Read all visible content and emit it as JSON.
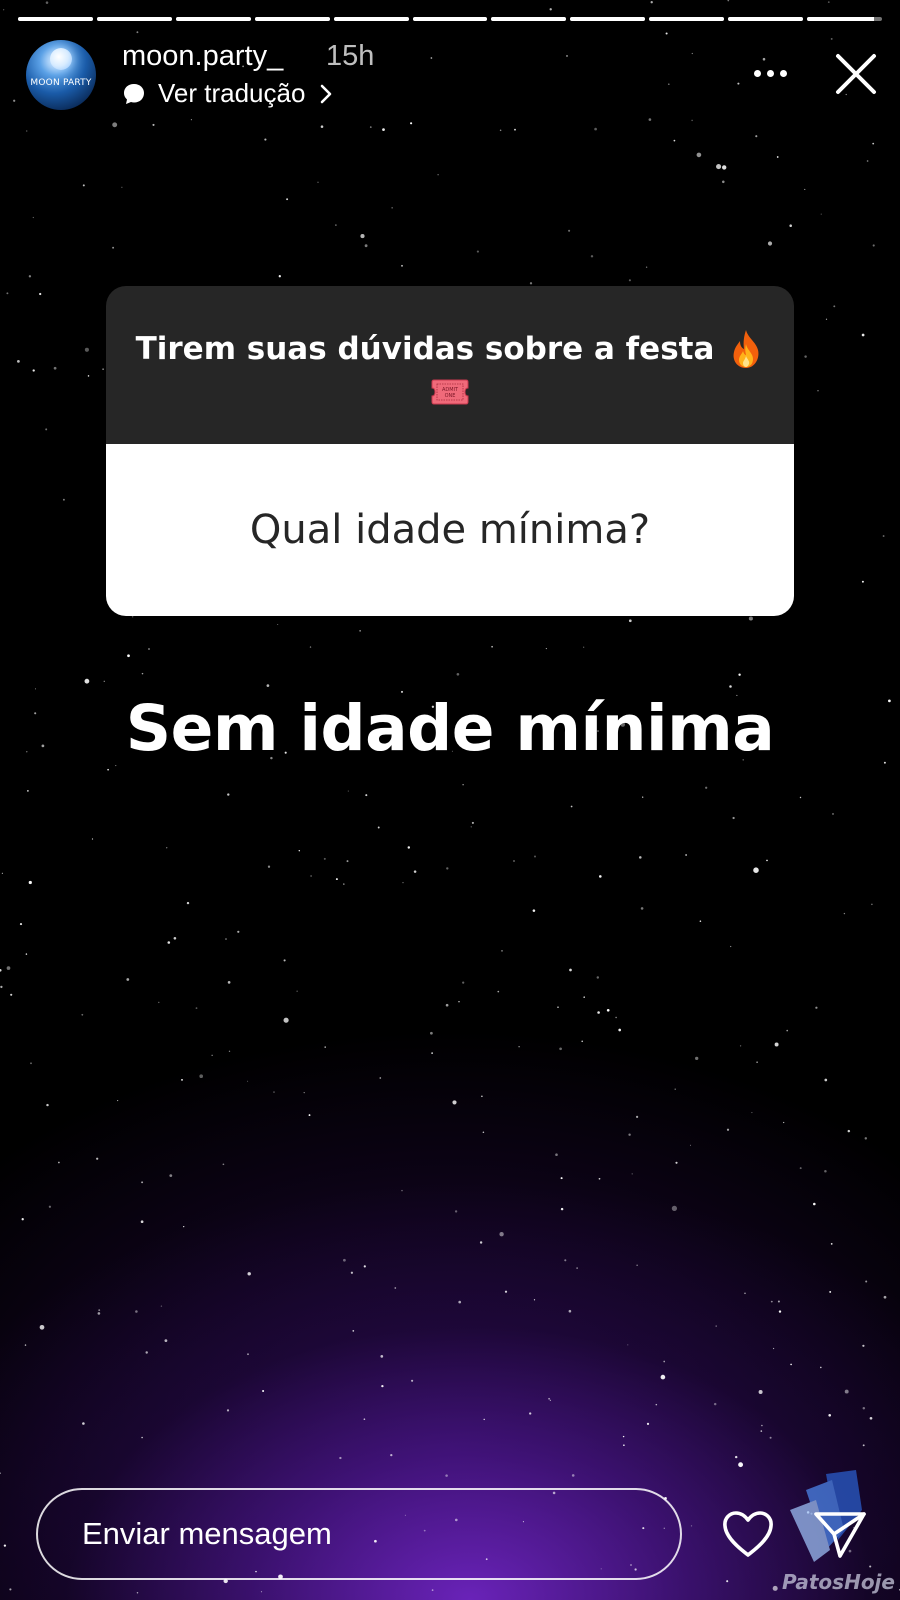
{
  "progress": {
    "segments_total": 11,
    "segments_viewed": 10,
    "current_segment_fraction": 0.9
  },
  "header": {
    "username": "moon.party_",
    "time_ago": "15h",
    "translate_label": "Ver tradução",
    "avatar_text": "MOON PARTY",
    "more_icon": "more-horizontal-icon",
    "close_icon": "close-icon"
  },
  "sticker": {
    "prompt": "Tirem suas dúvidas sobre a festa",
    "prompt_emoji": "fire-emoji",
    "ticket_emoji": "admit-one-ticket-emoji",
    "ticket_text": "ADMIT ONE",
    "question": "Qual idade mínima?"
  },
  "answer": "Sem idade mínima",
  "footer": {
    "message_placeholder": "Enviar mensagem",
    "like_icon": "heart-icon",
    "send_icon": "paper-plane-icon"
  },
  "watermark": {
    "text": "PatosHoje"
  },
  "colors": {
    "sticker_dark": "#262626",
    "sticker_light": "#ffffff",
    "background_glow": "#7a28d2"
  }
}
